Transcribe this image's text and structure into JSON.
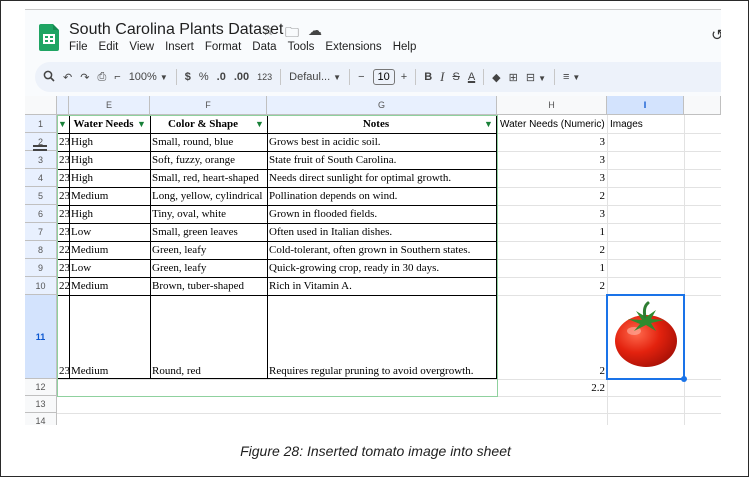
{
  "app": {
    "title": "South Carolina Plants Dataset",
    "menu": [
      "File",
      "Edit",
      "View",
      "Insert",
      "Format",
      "Data",
      "Tools",
      "Extensions",
      "Help"
    ],
    "brand_color": "#1fa463"
  },
  "toolbar": {
    "zoom": "100%",
    "currency": "$",
    "percent": "%",
    "dec_decrease": ".0",
    "dec_increase": ".00",
    "number_format": "123",
    "font": "Defaul...",
    "minus": "−",
    "font_size": "10",
    "plus": "+",
    "bold": "B",
    "italic": "I",
    "strike": "S",
    "text_color": "A"
  },
  "columns": [
    {
      "letter": "E",
      "header": "Water Needs"
    },
    {
      "letter": "F",
      "header": "Color & Shape"
    },
    {
      "letter": "G",
      "header": "Notes"
    },
    {
      "letter": "H",
      "header": "Water Needs (Numeric)"
    },
    {
      "letter": "I",
      "header": "Images"
    }
  ],
  "rows": [
    {
      "num": "1"
    },
    {
      "num": "2",
      "d": "23",
      "water": "High",
      "shape": "Small, round, blue",
      "notes": "Grows best in acidic soil.",
      "numeric": "3"
    },
    {
      "num": "3",
      "d": "23",
      "water": "High",
      "shape": "Soft, fuzzy, orange",
      "notes": "State fruit of South Carolina.",
      "numeric": "3"
    },
    {
      "num": "4",
      "d": "23",
      "water": "High",
      "shape": "Small, red, heart-shaped",
      "notes": "Needs direct sunlight for optimal growth.",
      "numeric": "3"
    },
    {
      "num": "5",
      "d": "23",
      "water": "Medium",
      "shape": "Long, yellow, cylindrical",
      "notes": "Pollination depends on wind.",
      "numeric": "2"
    },
    {
      "num": "6",
      "d": "23",
      "water": "High",
      "shape": "Tiny, oval, white",
      "notes": "Grown in flooded fields.",
      "numeric": "3"
    },
    {
      "num": "7",
      "d": "23",
      "water": "Low",
      "shape": "Small, green leaves",
      "notes": "Often used in Italian dishes.",
      "numeric": "1"
    },
    {
      "num": "8",
      "d": "22",
      "water": "Medium",
      "shape": "Green, leafy",
      "notes": "Cold-tolerant, often grown in Southern states.",
      "numeric": "2"
    },
    {
      "num": "9",
      "d": "23",
      "water": "Low",
      "shape": "Green, leafy",
      "notes": "Quick-growing crop, ready in 30 days.",
      "numeric": "1"
    },
    {
      "num": "10",
      "d": "22",
      "water": "Medium",
      "shape": "Brown, tuber-shaped",
      "notes": "Rich in Vitamin A.",
      "numeric": "2"
    },
    {
      "num": "11",
      "d": "23",
      "water": "Medium",
      "shape": "Round, red",
      "notes": "Requires regular pruning to avoid overgrowth.",
      "numeric": "2",
      "image": "tomato"
    },
    {
      "num": "12",
      "numeric": "2.2"
    },
    {
      "num": "13"
    },
    {
      "num": "14"
    }
  ],
  "caption": "Figure 28: Inserted tomato image into sheet"
}
